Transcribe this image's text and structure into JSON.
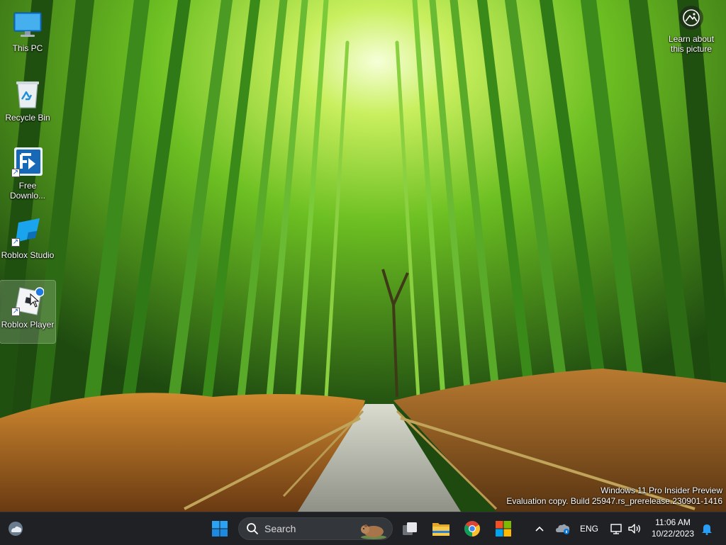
{
  "desktop": {
    "icons": [
      {
        "label": "This PC"
      },
      {
        "label": "Recycle Bin"
      },
      {
        "label": "Free Downlo..."
      },
      {
        "label": "Roblox Studio"
      },
      {
        "label": "Roblox Player"
      }
    ],
    "learn_label": "Learn about this picture",
    "watermark": {
      "line1": "Windows 11 Pro Insider Preview",
      "line2": "Evaluation copy. Build 25947.rs_prerelease.230901-1416"
    }
  },
  "taskbar": {
    "search_placeholder": "Search",
    "pinned_icons": [
      "start-icon",
      "task-view-icon",
      "file-explorer-icon",
      "chrome-icon",
      "microsoft-store-icon"
    ],
    "tray": {
      "language": "ENG",
      "time": "11:06 AM",
      "date": "10/22/2023"
    }
  },
  "colors": {
    "taskbar_bg": "#1f2125",
    "accent": "#0b79d6"
  }
}
